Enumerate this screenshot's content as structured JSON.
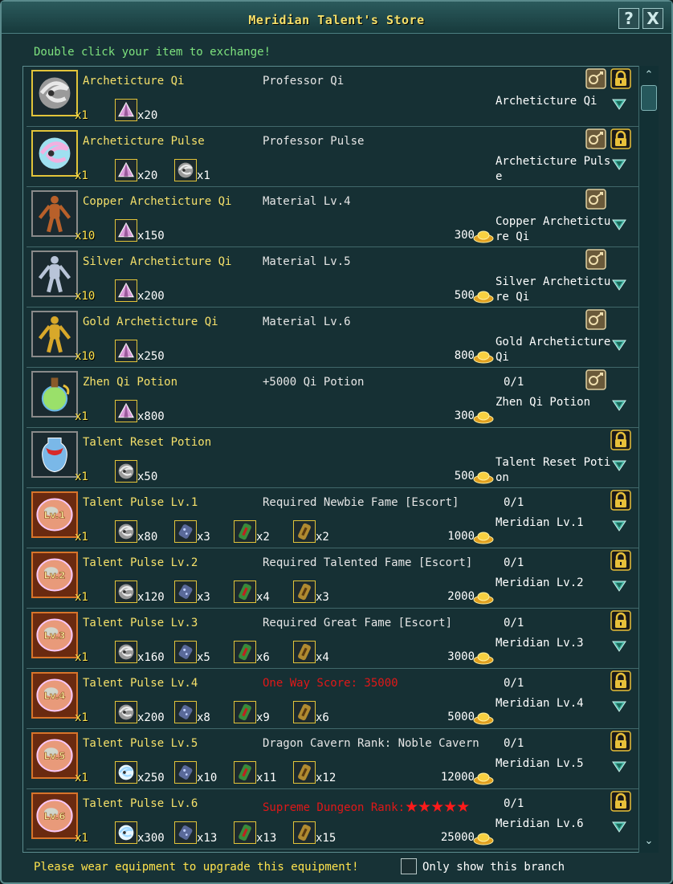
{
  "window": {
    "title": "Meridian Talent's Store",
    "help_glyph": "?",
    "close_glyph": "X",
    "hint": "Double click your item to exchange!"
  },
  "footer": {
    "message": "Please wear equipment to upgrade this equipment!",
    "checkbox_label": "Only show this branch",
    "checkbox_checked": false
  },
  "colors": {
    "name_text": "#f5e06a",
    "hint_text": "#7ee27e",
    "alert_text": "#e01818",
    "panel_bg": "#163034"
  },
  "rows": [
    {
      "name": "Archeticture Qi",
      "icon": "swirl-orb-gray",
      "frame": "gold",
      "qty": "x1",
      "requirement": "Professor Qi",
      "req_red": false,
      "req_stars": "",
      "materials": [
        {
          "icon": "pink-crystal",
          "count": "x20"
        }
      ],
      "cost": "",
      "limit": "",
      "result": "Archeticture Qi",
      "bind_icon": true,
      "lock_icon": true
    },
    {
      "name": "Archeticture Pulse",
      "icon": "swirl-orb-rainbow",
      "frame": "gold",
      "qty": "x1",
      "requirement": "Professor Pulse",
      "req_red": false,
      "req_stars": "",
      "materials": [
        {
          "icon": "pink-crystal",
          "count": "x20"
        },
        {
          "icon": "swirl-orb-gray",
          "count": "x1"
        }
      ],
      "cost": "",
      "limit": "",
      "result": "Archeticture Pulse",
      "bind_icon": true,
      "lock_icon": true
    },
    {
      "name": "Copper Archeticture Qi",
      "icon": "copper-figure",
      "frame": "gray",
      "qty": "x10",
      "requirement": "Material Lv.4",
      "req_red": false,
      "req_stars": "",
      "materials": [
        {
          "icon": "pink-crystal",
          "count": "x150"
        }
      ],
      "cost": "300",
      "limit": "",
      "result": "Copper Archeticture Qi",
      "bind_icon": true,
      "lock_icon": false
    },
    {
      "name": "Silver Archeticture Qi",
      "icon": "silver-figure",
      "frame": "gray",
      "qty": "x10",
      "requirement": "Material Lv.5",
      "req_red": false,
      "req_stars": "",
      "materials": [
        {
          "icon": "pink-crystal",
          "count": "x200"
        }
      ],
      "cost": "500",
      "limit": "",
      "result": "Silver Archeticture Qi",
      "bind_icon": true,
      "lock_icon": false
    },
    {
      "name": "Gold Archeticture Qi",
      "icon": "gold-figure",
      "frame": "gray",
      "qty": "x10",
      "requirement": "Material Lv.6",
      "req_red": false,
      "req_stars": "",
      "materials": [
        {
          "icon": "pink-crystal",
          "count": "x250"
        }
      ],
      "cost": "800",
      "limit": "",
      "result": "Gold Archeticture Qi",
      "bind_icon": true,
      "lock_icon": false
    },
    {
      "name": "Zhen Qi Potion",
      "icon": "green-potion",
      "frame": "gray",
      "qty": "x1",
      "requirement": "+5000 Qi Potion",
      "req_red": false,
      "req_stars": "",
      "materials": [
        {
          "icon": "pink-crystal",
          "count": "x800"
        }
      ],
      "cost": "300",
      "limit": "0/1",
      "result": "Zhen Qi Potion",
      "bind_icon": true,
      "lock_icon": false
    },
    {
      "name": "Talent Reset Potion",
      "icon": "vase-potion",
      "frame": "gray",
      "qty": "x1",
      "requirement": "",
      "req_red": false,
      "req_stars": "",
      "materials": [
        {
          "icon": "swirl-orb-gray",
          "count": "x50"
        }
      ],
      "cost": "500",
      "limit": "",
      "result": "Talent Reset Potion",
      "bind_icon": false,
      "lock_icon": true
    },
    {
      "name": "Talent Pulse Lv.1",
      "icon": "talent-orb",
      "badge": "Lv.1",
      "frame": "orange",
      "qty": "x1",
      "requirement": "Required Newbie Fame [Escort]",
      "req_red": false,
      "req_stars": "",
      "materials": [
        {
          "icon": "swirl-orb-gray",
          "count": "x80"
        },
        {
          "icon": "blue-ore",
          "count": "x3"
        },
        {
          "icon": "green-scroll",
          "count": "x2"
        },
        {
          "icon": "gold-scroll",
          "count": "x2"
        }
      ],
      "cost": "1000",
      "limit": "0/1",
      "result": "Meridian Lv.1",
      "bind_icon": false,
      "lock_icon": true
    },
    {
      "name": "Talent Pulse Lv.2",
      "icon": "talent-orb",
      "badge": "Lv.2",
      "frame": "orange",
      "qty": "x1",
      "requirement": "Required Talented Fame [Escort]",
      "req_red": false,
      "req_stars": "",
      "materials": [
        {
          "icon": "swirl-orb-gray",
          "count": "x120"
        },
        {
          "icon": "blue-ore",
          "count": "x3"
        },
        {
          "icon": "green-scroll",
          "count": "x4"
        },
        {
          "icon": "gold-scroll",
          "count": "x3"
        }
      ],
      "cost": "2000",
      "limit": "0/1",
      "result": "Meridian Lv.2",
      "bind_icon": false,
      "lock_icon": true
    },
    {
      "name": "Talent Pulse Lv.3",
      "icon": "talent-orb",
      "badge": "Lv.3",
      "frame": "orange",
      "qty": "x1",
      "requirement": "Required Great Fame [Escort]",
      "req_red": false,
      "req_stars": "",
      "materials": [
        {
          "icon": "swirl-orb-gray",
          "count": "x160"
        },
        {
          "icon": "blue-ore",
          "count": "x5"
        },
        {
          "icon": "green-scroll",
          "count": "x6"
        },
        {
          "icon": "gold-scroll",
          "count": "x4"
        }
      ],
      "cost": "3000",
      "limit": "0/1",
      "result": "Meridian Lv.3",
      "bind_icon": false,
      "lock_icon": true
    },
    {
      "name": "Talent Pulse Lv.4",
      "icon": "talent-orb",
      "badge": "Lv.4",
      "frame": "orange",
      "qty": "x1",
      "requirement": "One Way Score: 35000",
      "req_red": true,
      "req_stars": "",
      "materials": [
        {
          "icon": "swirl-orb-gray",
          "count": "x200"
        },
        {
          "icon": "blue-ore",
          "count": "x8"
        },
        {
          "icon": "green-scroll",
          "count": "x9"
        },
        {
          "icon": "gold-scroll",
          "count": "x6"
        }
      ],
      "cost": "5000",
      "limit": "0/1",
      "result": "Meridian Lv.4",
      "bind_icon": false,
      "lock_icon": true
    },
    {
      "name": "Talent Pulse Lv.5",
      "icon": "talent-orb",
      "badge": "Lv.5",
      "frame": "orange",
      "qty": "x1",
      "requirement": "Dragon Cavern Rank: Noble Cavern",
      "req_red": false,
      "req_stars": "",
      "materials": [
        {
          "icon": "swirl-orb-blue",
          "count": "x250"
        },
        {
          "icon": "blue-ore",
          "count": "x10"
        },
        {
          "icon": "green-scroll",
          "count": "x11"
        },
        {
          "icon": "gold-scroll",
          "count": "x12"
        }
      ],
      "cost": "12000",
      "limit": "0/1",
      "result": "Meridian Lv.5",
      "bind_icon": false,
      "lock_icon": true
    },
    {
      "name": "Talent Pulse Lv.6",
      "icon": "talent-orb",
      "badge": "Lv.6",
      "frame": "orange",
      "qty": "x1",
      "requirement": "Supreme Dungeon Rank:",
      "req_red": true,
      "req_stars": "★★★★★",
      "materials": [
        {
          "icon": "swirl-orb-blue",
          "count": "x300"
        },
        {
          "icon": "blue-ore",
          "count": "x13"
        },
        {
          "icon": "green-scroll",
          "count": "x13"
        },
        {
          "icon": "gold-scroll",
          "count": "x15"
        }
      ],
      "cost": "25000",
      "limit": "0/1",
      "result": "Meridian Lv.6",
      "bind_icon": false,
      "lock_icon": true
    }
  ]
}
